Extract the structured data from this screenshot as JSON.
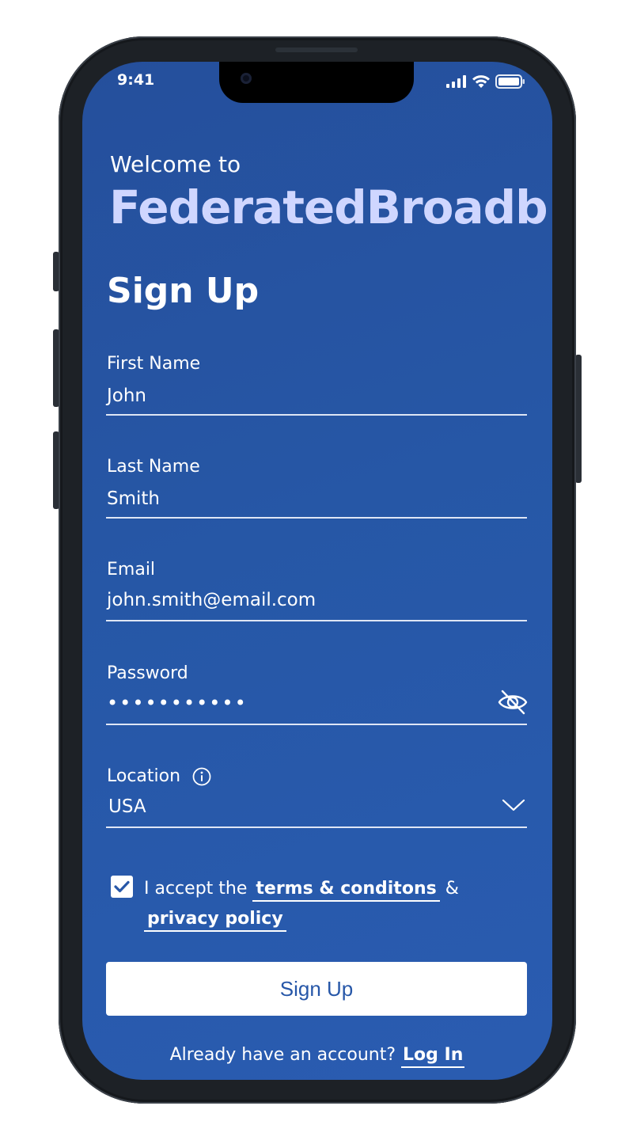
{
  "status_bar": {
    "time": "9:41",
    "icons": [
      "signal-icon",
      "wifi-icon",
      "battery-icon"
    ]
  },
  "header": {
    "welcome": "Welcome to",
    "brand": "FederatedBroadb"
  },
  "form": {
    "title": "Sign Up",
    "first_name": {
      "label": "First Name",
      "value": "John"
    },
    "last_name": {
      "label": "Last Name",
      "value": "Smith"
    },
    "email": {
      "label": "Email",
      "value": "john.smith@email.com"
    },
    "password": {
      "label": "Password",
      "value": "•••••••••••",
      "toggle_icon": "eye-off-icon"
    },
    "location": {
      "label": "Location",
      "value": "USA",
      "info_icon": "info-icon",
      "dropdown_icon": "chevron-down-icon"
    },
    "terms": {
      "checked": true,
      "prefix": "I accept the",
      "terms_link": "terms & conditons",
      "joiner": "&",
      "privacy_link": "privacy policy"
    },
    "submit_label": "Sign Up"
  },
  "footer": {
    "prompt": "Already have an account?",
    "login_link": "Log In"
  },
  "colors": {
    "background": "#2657a6",
    "brand_text": "#cfd6ff",
    "button_bg": "#ffffff",
    "button_text": "#2757a8"
  }
}
